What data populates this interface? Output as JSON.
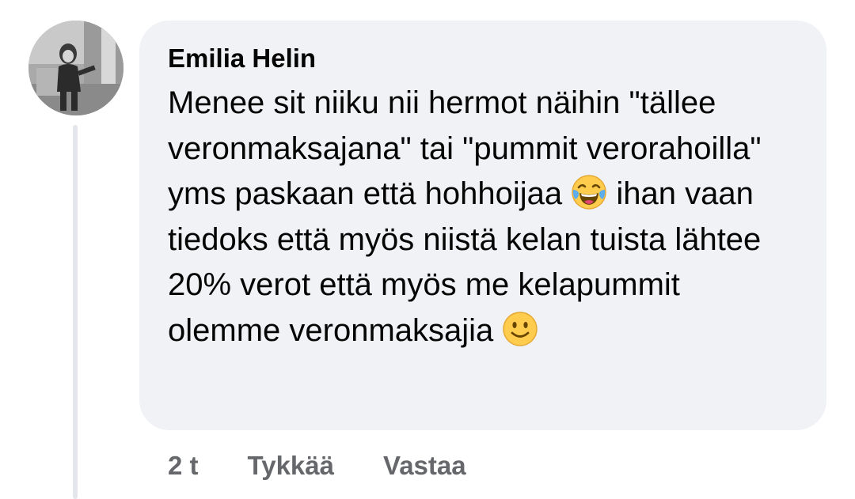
{
  "comment": {
    "author": "Emilia Helin",
    "text_parts": [
      "Menee sit niiku nii hermot näihin \"tällee veronmaksajana\" tai \"pummit verorahoilla\" yms paskaan että hohhoijaa ",
      " ihan vaan tiedoks että myös niistä kelan tuista lähtee 20% verot että myös me kelapummit olemme veronmaksajia "
    ],
    "emojis": [
      "face-with-tears-of-joy",
      "slightly-smiling-face"
    ],
    "timestamp": "2 t",
    "like_label": "Tykkää",
    "reply_label": "Vastaa"
  },
  "colors": {
    "bubble_background": "#f0f2f5",
    "text_primary": "#050505",
    "text_secondary": "#65676b",
    "thread_line": "#e4e6eb"
  }
}
